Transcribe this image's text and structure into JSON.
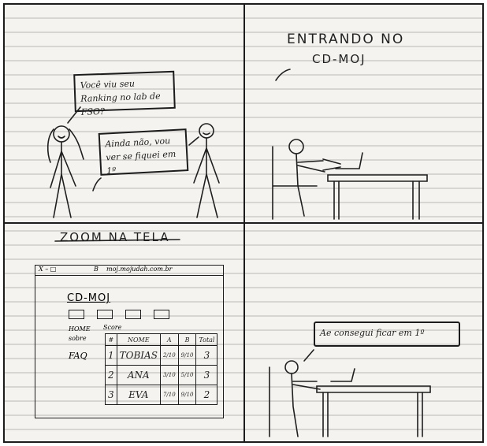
{
  "panel1": {
    "bubble_left": "Você viu seu Ranking no lab de FSO?",
    "bubble_right": "Ainda não, vou ver se fiquei em 1º"
  },
  "panel2": {
    "title_line1": "ENTRANDO NO",
    "title_line2": "CD-MOJ"
  },
  "panel3": {
    "title": "ZOOM NA TELA",
    "browser": {
      "window_controls": "X – □",
      "bookmark": "B",
      "url": "moj.mojudah.com.br"
    },
    "site_title": "CD-MOJ",
    "side_links": [
      "HOME",
      "sobre",
      "FAQ"
    ],
    "score_label": "Score",
    "table": {
      "headers": [
        "#",
        "NOME",
        "A",
        "B",
        "Total"
      ],
      "rows": [
        {
          "pos": "1",
          "name": "TOBIAS",
          "a": "2/10",
          "b": "9/10",
          "total": "3"
        },
        {
          "pos": "2",
          "name": "ANA",
          "a": "3/10",
          "b": "5/10",
          "total": "3"
        },
        {
          "pos": "3",
          "name": "EVA",
          "a": "7/10",
          "b": "9/10",
          "total": "2"
        }
      ]
    }
  },
  "panel4": {
    "bubble": "Ae consegui ficar em 1º"
  }
}
